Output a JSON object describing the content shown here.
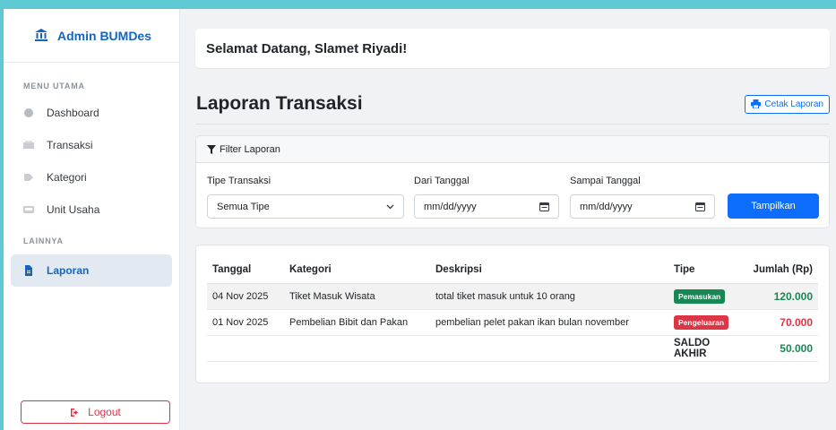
{
  "sidebar": {
    "brand": "Admin BUMDes",
    "section_main": "MENU UTAMA",
    "section_other": "LAINNYA",
    "items": [
      {
        "label": "Dashboard"
      },
      {
        "label": "Transaksi"
      },
      {
        "label": "Kategori"
      },
      {
        "label": "Unit Usaha"
      },
      {
        "label": "Laporan"
      }
    ],
    "logout": "Logout"
  },
  "header": {
    "welcome": "Selamat Datang, Slamet Riyadi!"
  },
  "page": {
    "title": "Laporan Transaksi",
    "print_label": "Cetak Laporan"
  },
  "filter": {
    "header": "Filter Laporan",
    "type_label": "Tipe Transaksi",
    "type_value": "Semua Tipe",
    "from_label": "Dari Tanggal",
    "from_value": "mm/dd/yyyy",
    "to_label": "Sampai Tanggal",
    "to_value": "mm/dd/yyyy",
    "apply": "Tampilkan"
  },
  "table": {
    "columns": [
      "Tanggal",
      "Kategori",
      "Deskripsi",
      "Tipe",
      "Jumlah (Rp)"
    ],
    "rows": [
      {
        "date": "04 Nov 2025",
        "category": "Tiket Masuk Wisata",
        "desc": "total tiket masuk untuk 10 orang",
        "type": "Pemasukan",
        "amount": "120.000"
      },
      {
        "date": "01 Nov 2025",
        "category": "Pembelian Bibit dan Pakan",
        "desc": "pembelian pelet pakan ikan bulan november",
        "type": "Pengeluaran",
        "amount": "70.000"
      }
    ],
    "saldo_label": "SALDO AKHIR",
    "saldo_value": "50.000"
  },
  "colors": {
    "primary": "#0d6efd",
    "brand": "#1565c0",
    "income": "#198754",
    "expense": "#dc3545"
  }
}
